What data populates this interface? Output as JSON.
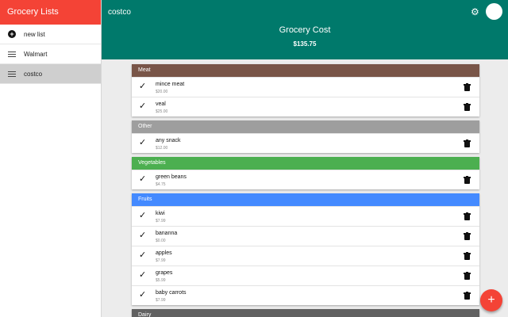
{
  "sidebar": {
    "title": "Grocery Lists",
    "new_list_label": "new list",
    "lists": [
      {
        "label": "Walmart",
        "active": false
      },
      {
        "label": "costco",
        "active": true
      }
    ]
  },
  "topbar": {
    "title": "costco",
    "cost_label": "Grocery Cost",
    "cost_value": "$135.75"
  },
  "categories": [
    {
      "name": "Meat",
      "color": "#795548",
      "items": [
        {
          "name": "mince meat",
          "price": "$20.00"
        },
        {
          "name": "veal",
          "price": "$25.00"
        }
      ]
    },
    {
      "name": "Other",
      "color": "#9e9e9e",
      "items": [
        {
          "name": "any snack",
          "price": "$12.00"
        }
      ]
    },
    {
      "name": "Vegetables",
      "color": "#4caf50",
      "items": [
        {
          "name": "green beans",
          "price": "$4.75"
        }
      ]
    },
    {
      "name": "Fruits",
      "color": "#448aff",
      "items": [
        {
          "name": "kiwi",
          "price": "$7.99"
        },
        {
          "name": "bananna",
          "price": "$0.00"
        },
        {
          "name": "apples",
          "price": "$7.99"
        },
        {
          "name": "grapes",
          "price": "$5.99"
        },
        {
          "name": "baby carrots",
          "price": "$7.99"
        }
      ]
    },
    {
      "name": "Dairy",
      "color": "#616161",
      "items": []
    }
  ],
  "icons": {
    "check": "check-icon",
    "trash": "trash-icon",
    "settings": "gear-icon",
    "add": "plus-icon",
    "list": "list-icon"
  }
}
